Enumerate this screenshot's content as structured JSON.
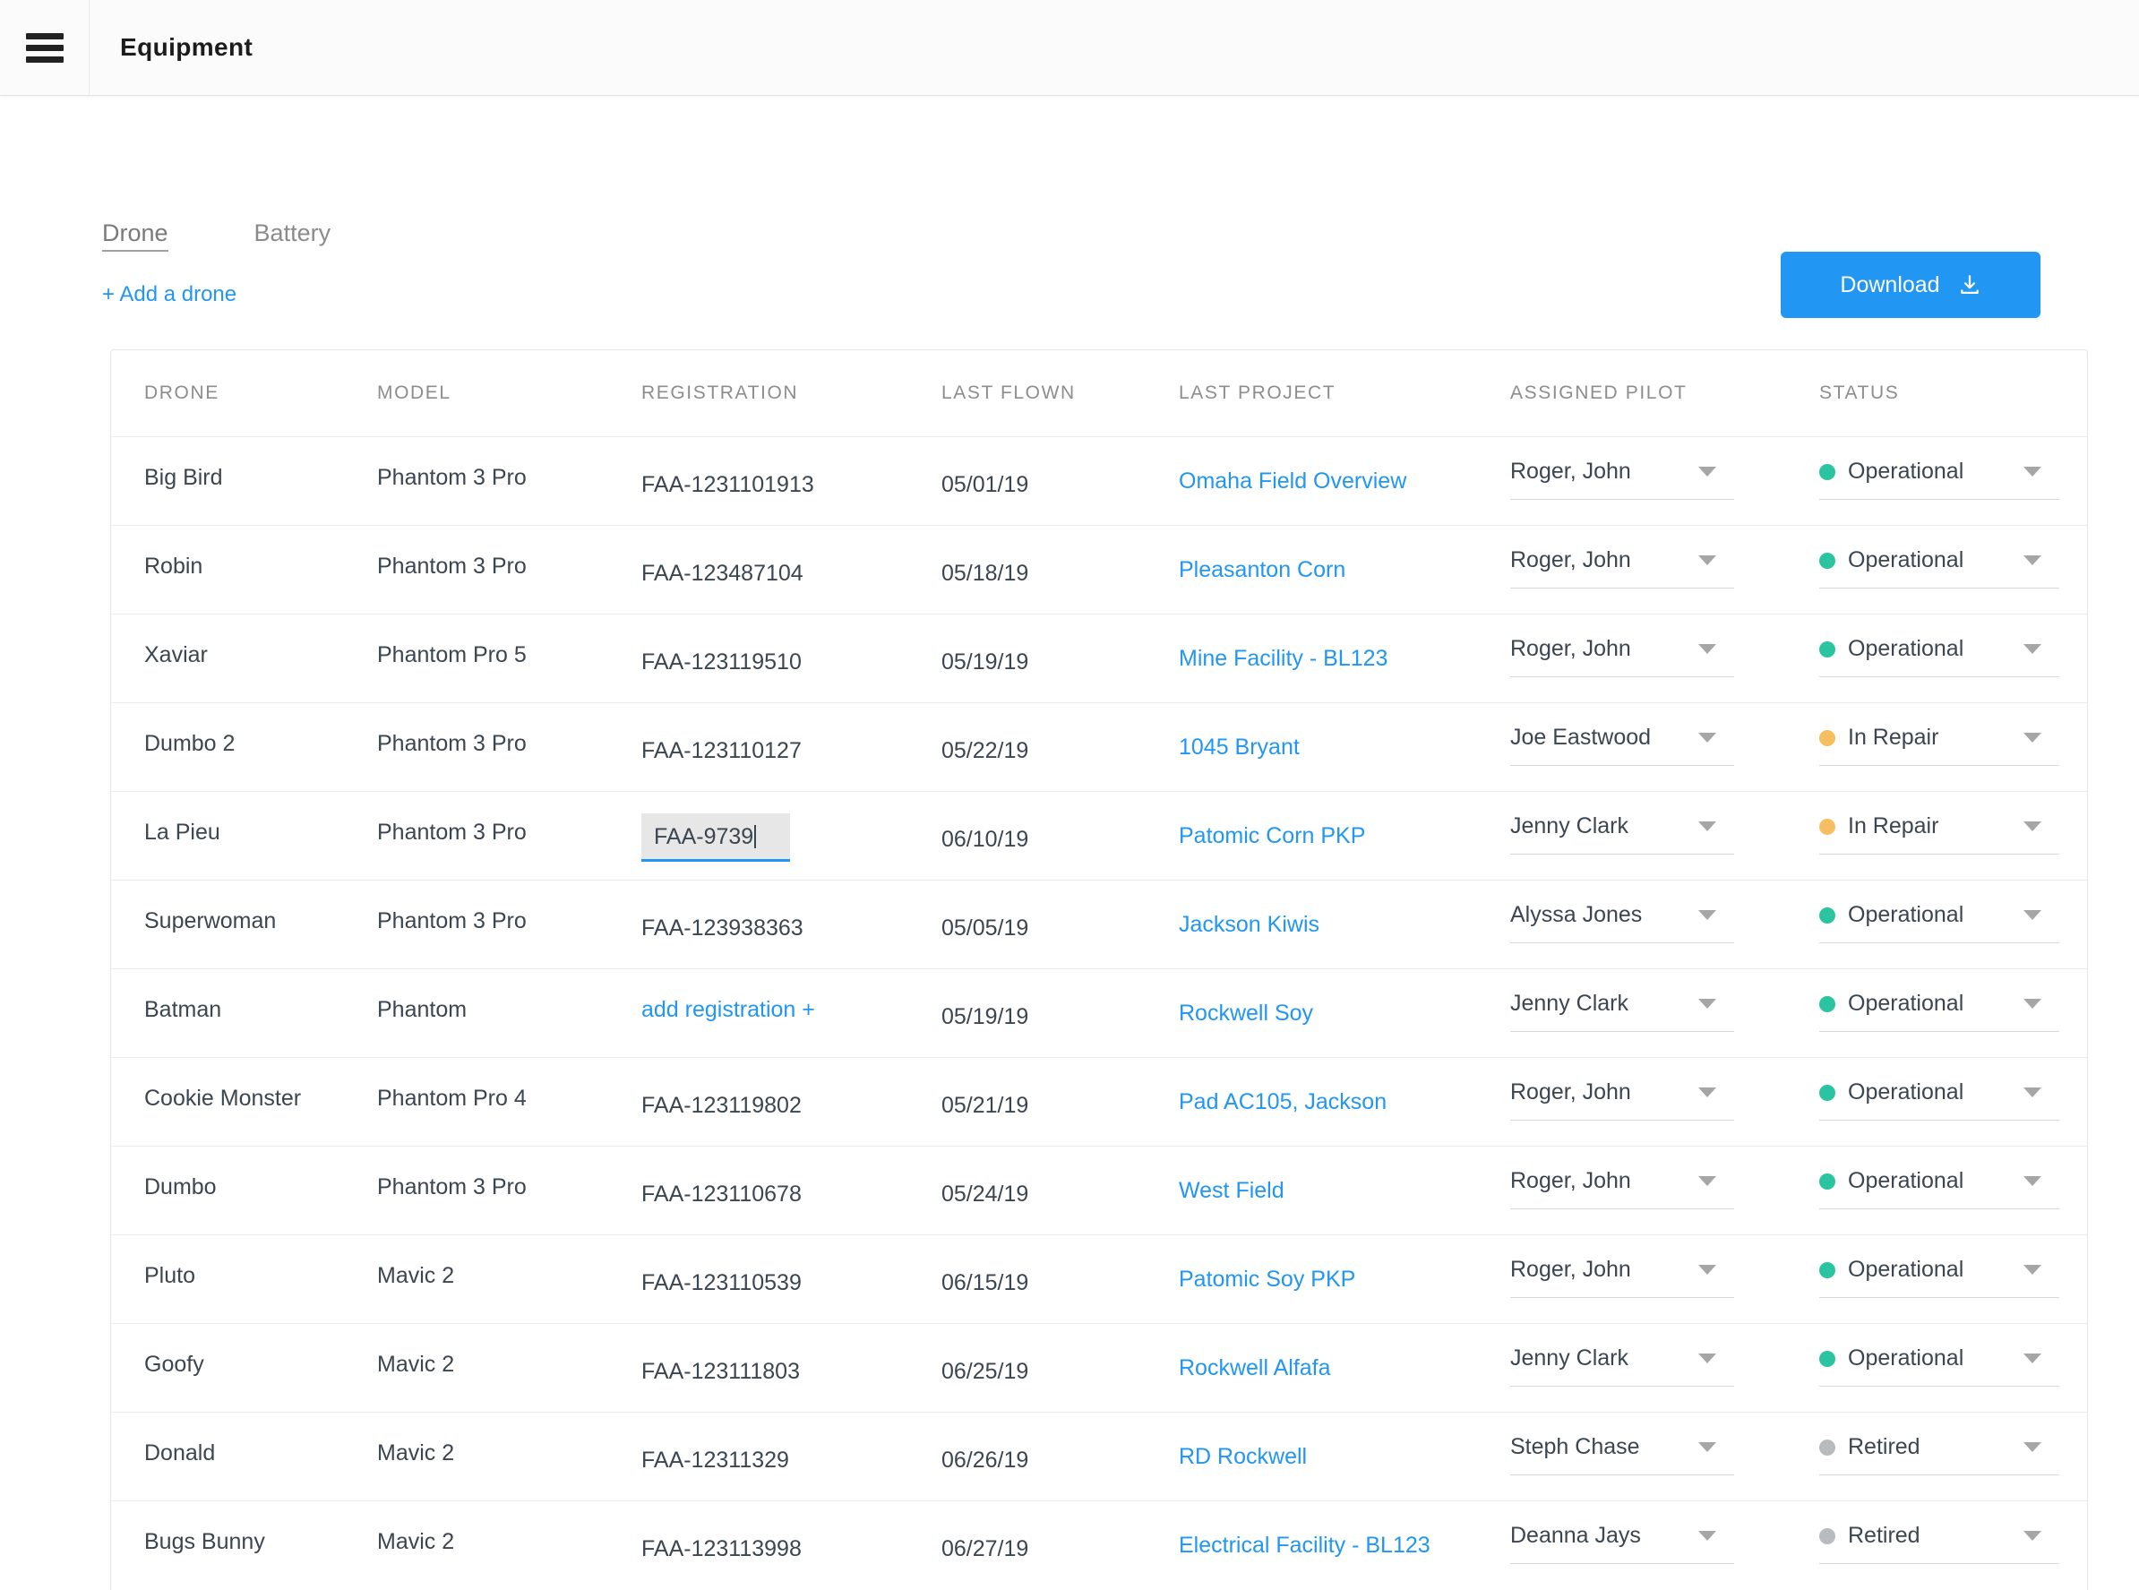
{
  "header": {
    "title": "Equipment",
    "menu_icon": "hamburger-icon"
  },
  "tabs": [
    {
      "label": "Drone",
      "active": true
    },
    {
      "label": "Battery",
      "active": false
    }
  ],
  "actions": {
    "add_drone_label": "+ Add a drone",
    "download_label": "Download",
    "download_icon": "download-icon"
  },
  "colors": {
    "accent_blue": "#2196f3",
    "operational_green": "#2bc4a0",
    "in_repair_amber": "#f8bf62",
    "retired_gray": "#b9bcbf",
    "link_blue": "#2196f3"
  },
  "table": {
    "columns": [
      "DRONE",
      "MODEL",
      "REGISTRATION",
      "LAST FLOWN",
      "LAST PROJECT",
      "ASSIGNED PILOT",
      "STATUS"
    ],
    "add_registration_label": "add registration +",
    "rows": [
      {
        "drone": "Big Bird",
        "model": "Phantom 3 Pro",
        "registration": "FAA-1231101913",
        "last_flown": "05/01/19",
        "last_project": "Omaha Field Overview",
        "pilot": "Roger, John",
        "status": "Operational",
        "status_color": "#2bc4a0"
      },
      {
        "drone": "Robin",
        "model": "Phantom 3 Pro",
        "registration": "FAA-123487104",
        "last_flown": "05/18/19",
        "last_project": "Pleasanton Corn",
        "pilot": "Roger, John",
        "status": "Operational",
        "status_color": "#2bc4a0"
      },
      {
        "drone": "Xaviar",
        "model": "Phantom Pro 5",
        "registration": "FAA-123119510",
        "last_flown": "05/19/19",
        "last_project": "Mine Facility - BL123",
        "pilot": "Roger, John",
        "status": "Operational",
        "status_color": "#2bc4a0"
      },
      {
        "drone": "Dumbo 2",
        "model": "Phantom 3 Pro",
        "registration": "FAA-123110127",
        "last_flown": "05/22/19",
        "last_project": "1045 Bryant",
        "pilot": "Joe Eastwood",
        "status": "In Repair",
        "status_color": "#f8bf62"
      },
      {
        "drone": "La Pieu",
        "model": "Phantom 3 Pro",
        "registration": "FAA-9739",
        "registration_editing": true,
        "last_flown": "06/10/19",
        "last_project": "Patomic Corn PKP",
        "pilot": "Jenny Clark",
        "status": "In Repair",
        "status_color": "#f8bf62"
      },
      {
        "drone": "Superwoman",
        "model": "Phantom 3 Pro",
        "registration": "FAA-123938363",
        "last_flown": "05/05/19",
        "last_project": "Jackson Kiwis",
        "pilot": "Alyssa Jones",
        "status": "Operational",
        "status_color": "#2bc4a0"
      },
      {
        "drone": "Batman",
        "model": "Phantom",
        "registration": "",
        "registration_missing": true,
        "last_flown": "05/19/19",
        "last_project": "Rockwell Soy",
        "pilot": "Jenny Clark",
        "status": "Operational",
        "status_color": "#2bc4a0"
      },
      {
        "drone": "Cookie Monster",
        "model": "Phantom Pro 4",
        "registration": "FAA-123119802",
        "last_flown": "05/21/19",
        "last_project": "Pad AC105, Jackson",
        "pilot": "Roger, John",
        "status": "Operational",
        "status_color": "#2bc4a0"
      },
      {
        "drone": "Dumbo",
        "model": "Phantom 3 Pro",
        "registration": "FAA-123110678",
        "last_flown": "05/24/19",
        "last_project": "West Field",
        "pilot": "Roger, John",
        "status": "Operational",
        "status_color": "#2bc4a0"
      },
      {
        "drone": "Pluto",
        "model": "Mavic 2",
        "registration": "FAA-123110539",
        "last_flown": "06/15/19",
        "last_project": "Patomic Soy PKP",
        "pilot": "Roger, John",
        "status": "Operational",
        "status_color": "#2bc4a0"
      },
      {
        "drone": "Goofy",
        "model": "Mavic 2",
        "registration": "FAA-123111803",
        "last_flown": "06/25/19",
        "last_project": "Rockwell Alfafa",
        "pilot": "Jenny Clark",
        "status": "Operational",
        "status_color": "#2bc4a0"
      },
      {
        "drone": "Donald",
        "model": "Mavic 2",
        "registration": "FAA-12311329",
        "last_flown": "06/26/19",
        "last_project": "RD Rockwell",
        "pilot": "Steph Chase",
        "status": "Retired",
        "status_color": "#b9bcbf"
      },
      {
        "drone": "Bugs Bunny",
        "model": "Mavic 2",
        "registration": "FAA-123113998",
        "last_flown": "06/27/19",
        "last_project": "Electrical Facility - BL123",
        "pilot": "Deanna Jays",
        "status": "Retired",
        "status_color": "#b9bcbf"
      }
    ]
  }
}
